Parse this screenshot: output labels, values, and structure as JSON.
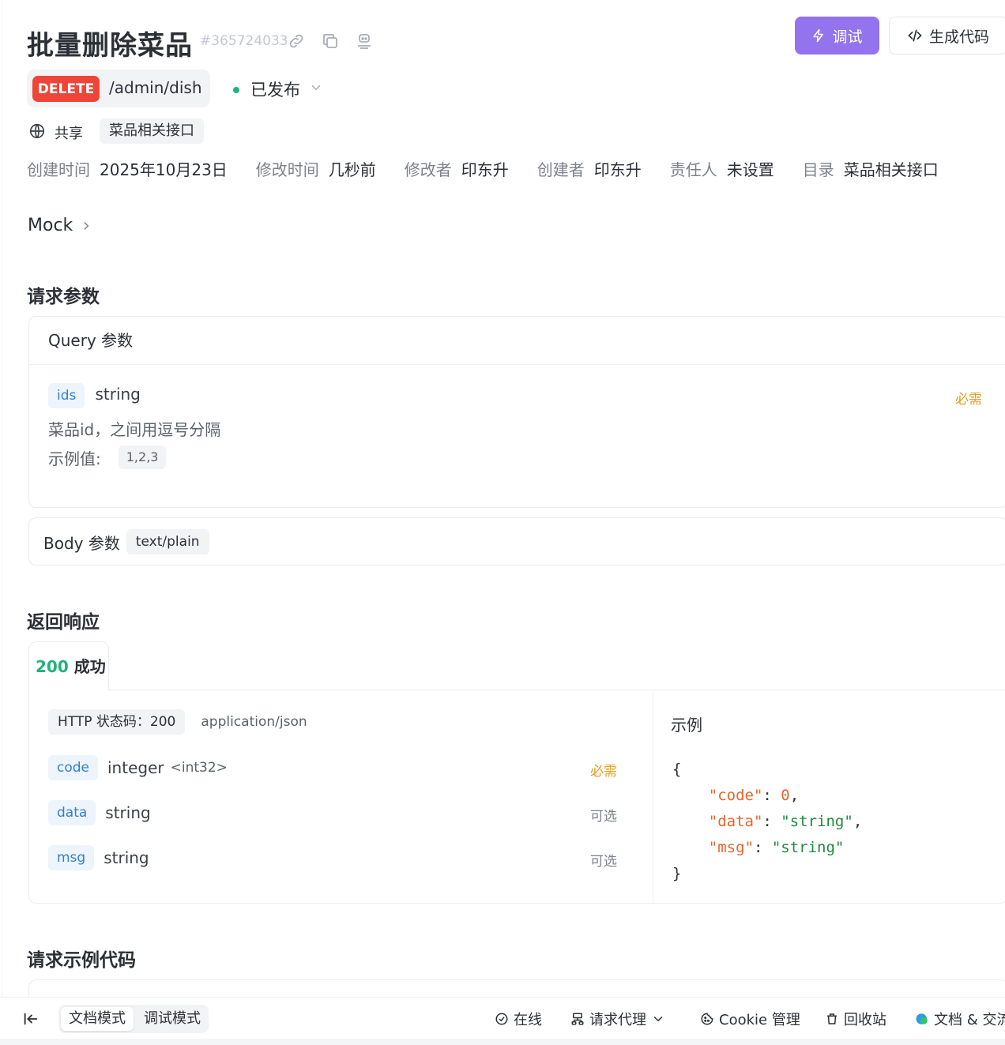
{
  "header": {
    "title": "批量删除菜品",
    "api_id": "#365724033",
    "debug_label": "调试",
    "gen_code_label": "生成代码"
  },
  "endpoint": {
    "method": "DELETE",
    "path": "/admin/dish",
    "status": "已发布"
  },
  "share": {
    "label": "共享",
    "folder": "菜品相关接口"
  },
  "meta": [
    {
      "key": "创建时间",
      "value": "2025年10月23日"
    },
    {
      "key": "修改时间",
      "value": "几秒前"
    },
    {
      "key": "修改者",
      "value": "印东升"
    },
    {
      "key": "创建者",
      "value": "印东升"
    },
    {
      "key": "责任人",
      "value": "未设置"
    },
    {
      "key": "目录",
      "value": "菜品相关接口"
    }
  ],
  "mock_label": "Mock",
  "request": {
    "section_title": "请求参数",
    "query_title": "Query 参数",
    "query_params": [
      {
        "name": "ids",
        "type": "string",
        "required": "必需",
        "description": "菜品id，之间用逗号分隔",
        "example_label": "示例值:",
        "example": "1,2,3"
      }
    ],
    "body_title": "Body 参数",
    "body_type": "text/plain"
  },
  "response": {
    "section_title": "返回响应",
    "tab_code": "200",
    "tab_label": "成功",
    "http_status": "HTTP 状态码：200",
    "content_type": "application/json",
    "fields": [
      {
        "name": "code",
        "type": "integer",
        "format": "<int32>",
        "flag": "必需"
      },
      {
        "name": "data",
        "type": "string",
        "format": "",
        "flag": "可选"
      },
      {
        "name": "msg",
        "type": "string",
        "format": "",
        "flag": "可选"
      }
    ],
    "example_title": "示例",
    "example": {
      "open": "{",
      "close": "}",
      "lines": [
        {
          "key": "\"code\"",
          "value": "0",
          "kind": "num",
          "comma": ","
        },
        {
          "key": "\"data\"",
          "value": "\"string\"",
          "kind": "str",
          "comma": ","
        },
        {
          "key": "\"msg\"",
          "value": "\"string\"",
          "kind": "str",
          "comma": ""
        }
      ]
    }
  },
  "code_section_title": "请求示例代码",
  "bottom_bar": {
    "mode_doc": "文档模式",
    "mode_debug": "调试模式",
    "online": "在线",
    "proxy": "请求代理",
    "cookie": "Cookie 管理",
    "recycle": "回收站",
    "docs": "文档 & 交流"
  },
  "colors": {
    "accent": "#9373ee",
    "delete": "#ee4538",
    "success": "#20b27a",
    "required": "#e49b1f",
    "param_blue": "#2f80d5"
  }
}
